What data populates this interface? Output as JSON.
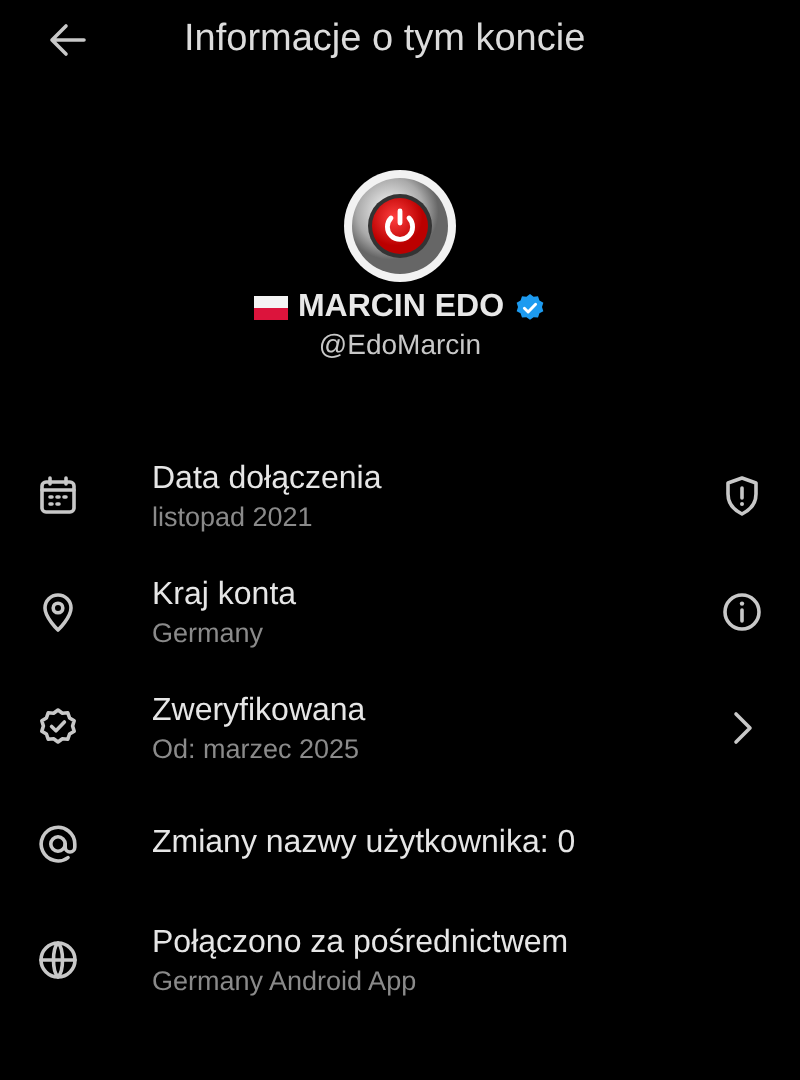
{
  "header": {
    "title": "Informacje o tym koncie"
  },
  "profile": {
    "name": "MARCIN EDO",
    "handle": "@EdoMarcin",
    "verified": true
  },
  "rows": [
    {
      "kind": "calendar",
      "label": "Data dołączenia",
      "detail": "listopad 2021",
      "trailing_icon": {
        "kind": "shield"
      }
    },
    {
      "kind": "pin",
      "label": "Kraj konta",
      "detail": "Germany",
      "trailing_icon": {
        "kind": "info"
      }
    },
    {
      "kind": "badge",
      "label": "Zweryfikowana",
      "detail": "Od: marzec 2025",
      "trailing_icon": {
        "kind": "chevron"
      }
    },
    {
      "kind": "at",
      "label": "Zmiany nazwy użytkownika: 0"
    },
    {
      "kind": "globe",
      "label": "Połączono za pośrednictwem",
      "detail": "Germany Android App"
    }
  ]
}
